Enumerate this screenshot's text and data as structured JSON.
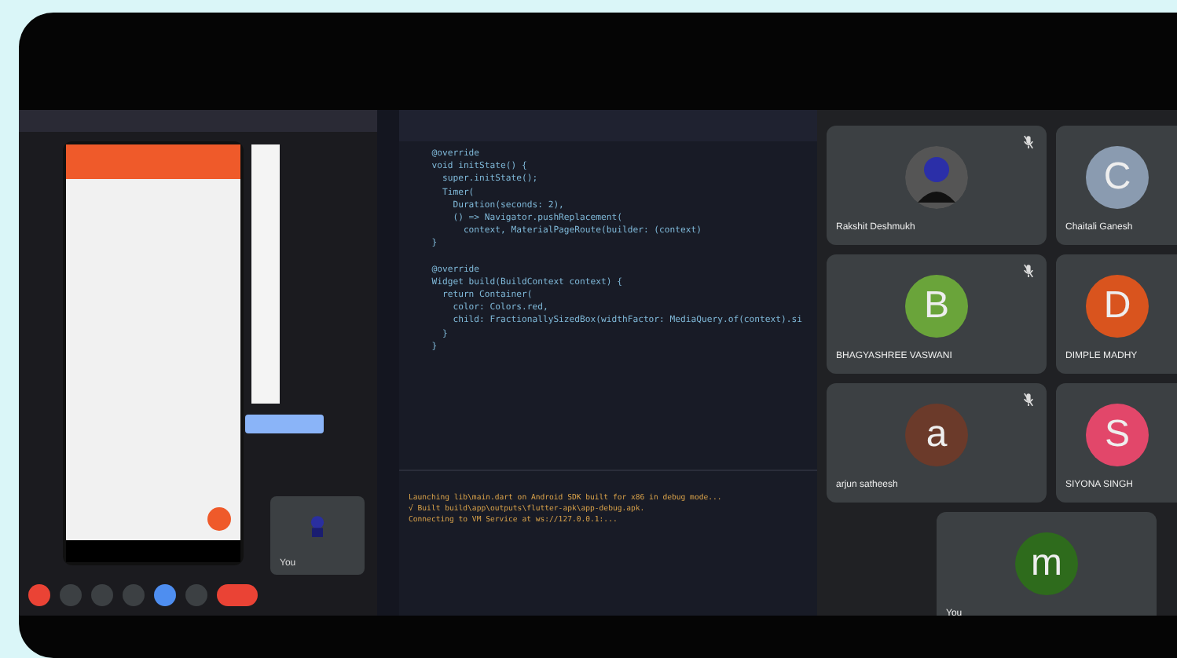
{
  "editor": {
    "code_blocks": [
      [
        "  @override",
        "  void initState() {",
        "    super.initState();",
        "    Timer(",
        "      Duration(seconds: 2),",
        "      () => Navigator.pushReplacement(",
        "        context, MaterialPageRoute(builder: (context)",
        "  }"
      ],
      [
        "  @override",
        "  Widget build(BuildContext context) {",
        "    return Container(",
        "      color: Colors.red,",
        "      child: FractionallySizedBox(widthFactor: MediaQuery.of(context).si",
        "    }",
        "  }"
      ]
    ],
    "terminal_lines": [
      "Launching lib\\main.dart on Android SDK built for x86 in debug mode...",
      "√  Built build\\app\\outputs\\flutter-apk\\app-debug.apk.",
      "Connecting to VM Service at ws://127.0.0.1:..."
    ]
  },
  "participants": [
    {
      "name": "Rakshit Deshmukh",
      "kind": "photo",
      "muted": true
    },
    {
      "name": "Chaitali Ganesh",
      "kind": "letter",
      "initial": "C",
      "color": "#8a9bb0",
      "muted": false
    },
    {
      "name": "BHAGYASHREE VASWANI",
      "kind": "letter",
      "initial": "B",
      "color": "#6aa43a",
      "muted": true
    },
    {
      "name": "DIMPLE MADHY",
      "kind": "letter",
      "initial": "D",
      "color": "#d9541e",
      "muted": false
    },
    {
      "name": "arjun satheesh",
      "kind": "letter",
      "initial": "a",
      "color": "#6b3a2a",
      "muted": true
    },
    {
      "name": "SIYONA SINGH",
      "kind": "letter",
      "initial": "S",
      "color": "#e2476a",
      "muted": false
    },
    {
      "name": "You",
      "kind": "letter",
      "initial": "m",
      "color": "#2e6b1c",
      "muted": false
    }
  ],
  "shared_meet": {
    "self_label": "You"
  }
}
